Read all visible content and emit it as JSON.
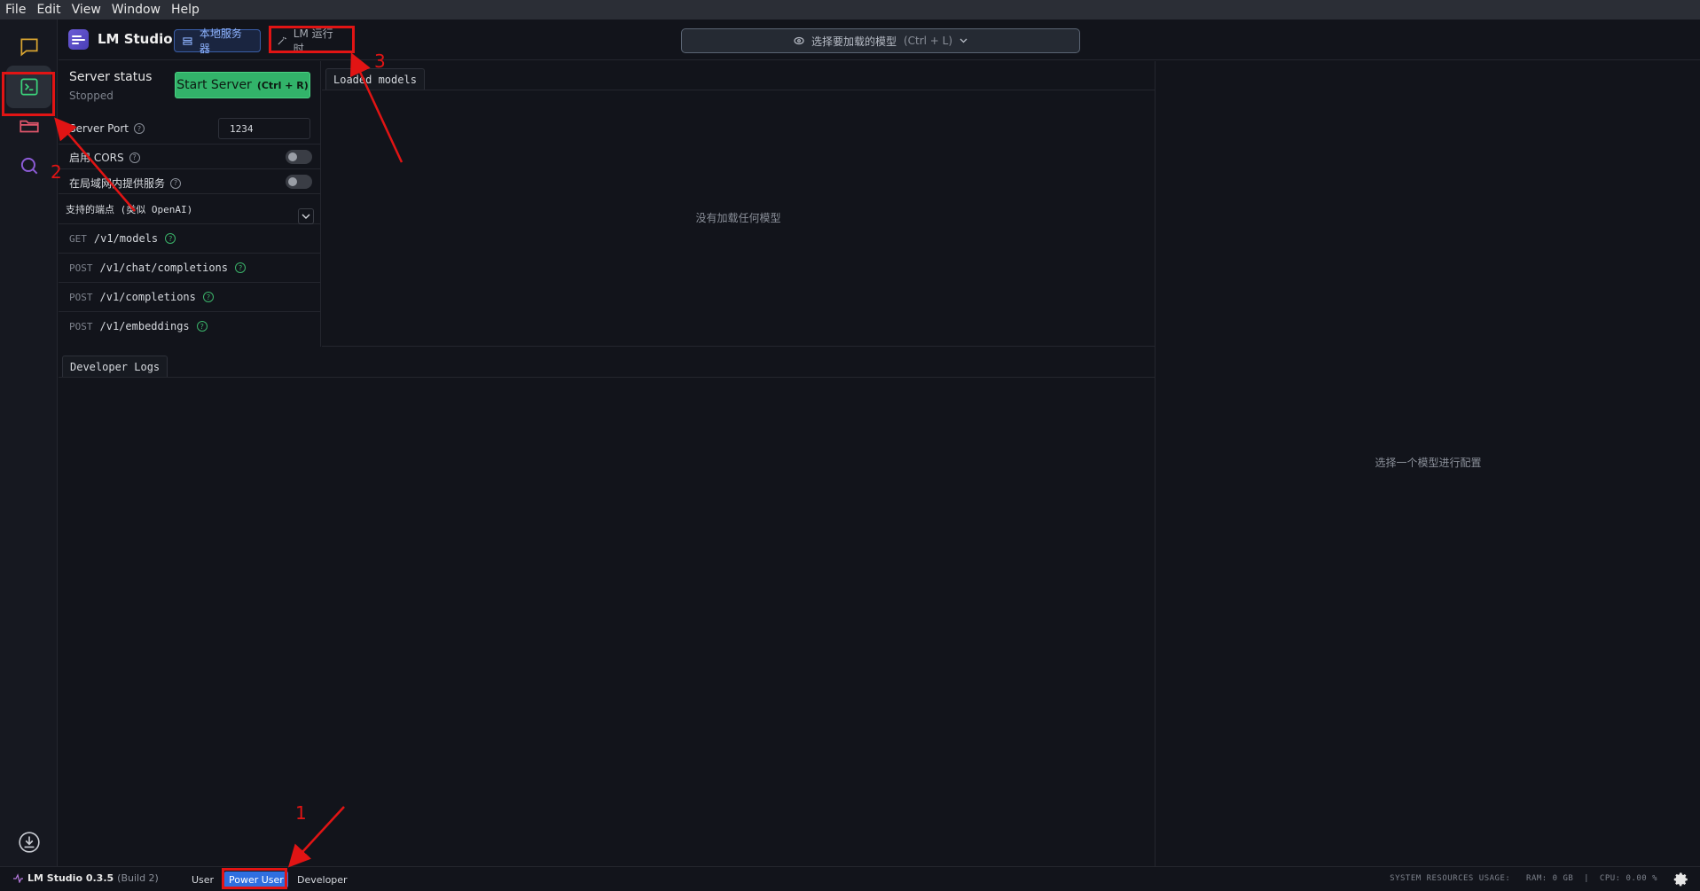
{
  "menu": [
    "File",
    "Edit",
    "View",
    "Window",
    "Help"
  ],
  "app": {
    "title": "LM Studio"
  },
  "header": {
    "local_server_tab": "本地服务器",
    "runtime_tab": "LM 运行时",
    "model_select": "选择要加载的模型",
    "model_select_shortcut": "(Ctrl + L)"
  },
  "server": {
    "status_label": "Server status",
    "status_value": "Stopped",
    "start_label": "Start Server",
    "start_shortcut": "(Ctrl + R)",
    "port_label": "Server Port",
    "port_value": "1234",
    "cors_label": "启用 CORS",
    "cors_enabled": false,
    "lan_label": "在局域网内提供服务",
    "lan_enabled": false,
    "endpoints_title": "支持的端点 (类似 OpenAI)",
    "endpoints": [
      {
        "method": "GET",
        "path": "/v1/models"
      },
      {
        "method": "POST",
        "path": "/v1/chat/completions"
      },
      {
        "method": "POST",
        "path": "/v1/completions"
      },
      {
        "method": "POST",
        "path": "/v1/embeddings"
      }
    ]
  },
  "models": {
    "tab": "Loaded models",
    "empty": "没有加载任何模型"
  },
  "logs": {
    "tab": "Developer Logs"
  },
  "config": {
    "hint": "选择一个模型进行配置"
  },
  "footer": {
    "version": "LM Studio 0.3.5",
    "build": "(Build 2)",
    "modes": [
      "User",
      "Power User",
      "Developer"
    ],
    "active_mode": "Power User",
    "resources": "SYSTEM RESOURCES USAGE:   RAM: 0 GB  |  CPU: 0.00 %"
  },
  "annotations": [
    "1",
    "2",
    "3"
  ],
  "colors": {
    "accent_green": "#32b36a",
    "accent_blue": "#2f6fe0",
    "annotation_red": "#e11414"
  }
}
